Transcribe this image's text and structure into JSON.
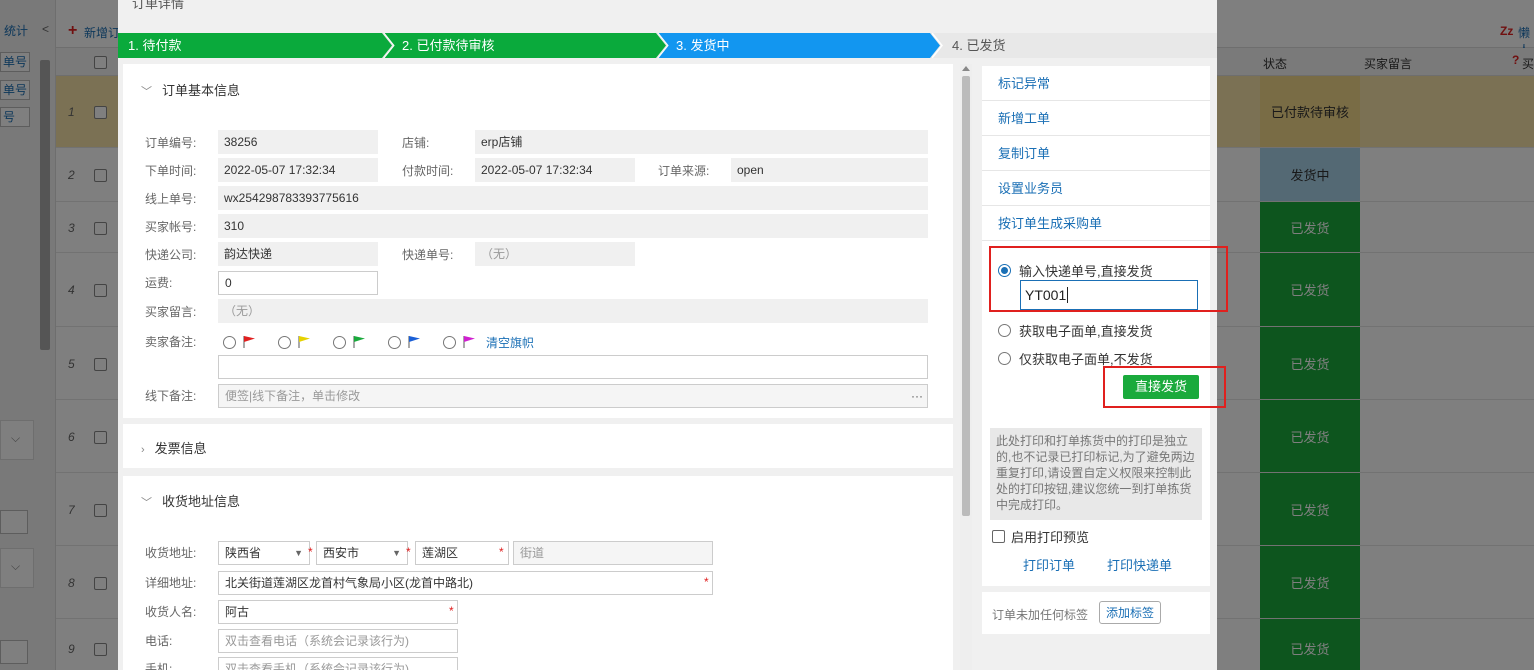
{
  "background": {
    "left_buttons": [
      "统计",
      "单号",
      "单号",
      "号"
    ],
    "toolbar_add": "新增订",
    "right_toolbar": "懒人",
    "columns": {
      "status": "状态",
      "buyer_msg": "买家留言",
      "buyer_col": "买"
    },
    "rows": [
      {
        "num": "1",
        "status": "已付款待审核",
        "color": "#f3d88a"
      },
      {
        "num": "2",
        "status": "发货中",
        "color": "#a9d2e8"
      },
      {
        "num": "3",
        "status": "已发货",
        "color": "#1aaa3c"
      },
      {
        "num": "4",
        "status": "已发货",
        "color": "#1aaa3c"
      },
      {
        "num": "5",
        "status": "已发货",
        "color": "#1aaa3c"
      },
      {
        "num": "6",
        "status": "已发货",
        "color": "#1aaa3c"
      },
      {
        "num": "7",
        "status": "已发货",
        "color": "#1aaa3c"
      },
      {
        "num": "8",
        "status": "已发货",
        "color": "#1aaa3c"
      },
      {
        "num": "9",
        "status": "已发货",
        "color": "#1aaa3c"
      }
    ]
  },
  "modal": {
    "title": "订单详情",
    "steps": [
      {
        "label": "1. 待付款",
        "color": "#0aaa3c"
      },
      {
        "label": "2. 已付款待审核",
        "color": "#0aaa3c"
      },
      {
        "label": "3. 发货中",
        "color": "#1296f0"
      },
      {
        "label": "4. 已发货",
        "color": "#e8e8e8"
      }
    ],
    "basic": {
      "title": "订单基本信息",
      "order_no_label": "订单编号:",
      "order_no": "38256",
      "shop_label": "店铺:",
      "shop": "erp店铺",
      "order_time_label": "下单时间:",
      "order_time": "2022-05-07 17:32:34",
      "pay_time_label": "付款时间:",
      "pay_time": "2022-05-07 17:32:34",
      "source_label": "订单来源:",
      "source": "open",
      "online_no_label": "线上单号:",
      "online_no": "wx254298783393775616",
      "buyer_label": "买家帐号:",
      "buyer": "310",
      "express_label": "快递公司:",
      "express": "韵达快递",
      "tracking_label": "快递单号:",
      "tracking": "（无）",
      "freight_label": "运费:",
      "freight": "0",
      "buyer_msg_label": "买家留言:",
      "buyer_msg": "（无）",
      "seller_note_label": "卖家备注:",
      "clear_flags": "清空旗帜",
      "offline_note_label": "线下备注:",
      "offline_note_placeholder": "便签|线下备注，单击修改",
      "more": "···"
    },
    "invoice": {
      "title": "发票信息"
    },
    "address": {
      "title": "收货地址信息",
      "addr_label": "收货地址:",
      "province": "陕西省",
      "city": "西安市",
      "district": "莲湖区",
      "street_placeholder": "街道",
      "detail_label": "详细地址:",
      "detail": "北关街道莲湖区龙首村气象局小区(龙首中路北)",
      "receiver_label": "收货人名:",
      "receiver": "阿古",
      "phone_label": "电话:",
      "phone_placeholder": "双击查看电话（系统会记录该行为)",
      "mobile_label": "手机:",
      "mobile_placeholder": "双击查看手机（系统会记录该行为)"
    },
    "actions": [
      "标记异常",
      "新增工单",
      "复制订单",
      "设置业务员",
      "按订单生成采购单"
    ],
    "ship": {
      "opt1": "输入快递单号,直接发货",
      "tracking_input": "YT001",
      "opt2": "获取电子面单,直接发货",
      "opt3": "仅获取电子面单,不发货",
      "ship_button": "直接发货"
    },
    "print_note": "此处打印和打单拣货中的打印是独立的,也不记录已打印标记,为了避免两边重复打印,请设置自定义权限来控制此处的打印按钮,建议您统一到打单拣货中完成打印。",
    "print_preview": "启用打印预览",
    "print_order": "打印订单",
    "print_express": "打印快递单",
    "tags_text": "订单未加任何标签",
    "add_tag": "添加标签"
  }
}
